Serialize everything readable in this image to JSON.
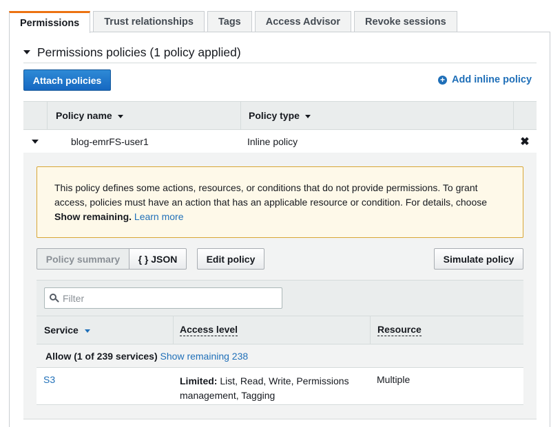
{
  "tabs": [
    "Permissions",
    "Trust relationships",
    "Tags",
    "Access Advisor",
    "Revoke sessions"
  ],
  "section_title": "Permissions policies (1 policy applied)",
  "attach_button": "Attach policies",
  "add_inline_label": "Add inline policy",
  "policy_table": {
    "headers": {
      "name": "Policy name",
      "type": "Policy type"
    },
    "row": {
      "name": "blog-emrFS-user1",
      "type": "Inline policy"
    }
  },
  "warning": {
    "text": "This policy defines some actions, resources, or conditions that do not provide permissions. To grant access, policies must have an action that has an applicable resource or condition. For details, choose ",
    "bold": "Show remaining.",
    "link": "Learn more"
  },
  "view_toggle": {
    "summary": "Policy summary",
    "json": "{ } JSON"
  },
  "edit_policy": "Edit policy",
  "simulate_policy": "Simulate policy",
  "filter_placeholder": "Filter",
  "summary_table": {
    "headers": {
      "service": "Service",
      "access": "Access level",
      "resource": "Resource"
    },
    "allow_text": "Allow (1 of 239 services)",
    "show_remaining": "Show remaining 238",
    "rows": [
      {
        "service": "S3",
        "access_bold": "Limited:",
        "access_rest": "List, Read, Write, Permissions management, Tagging",
        "resource": "Multiple"
      }
    ]
  },
  "colors": {
    "accent_tab": "#ec7211",
    "primary_button": "#1668c1",
    "link": "#1f6fb8",
    "warning_bg": "#fef9e9",
    "warning_border": "#d8a634"
  }
}
